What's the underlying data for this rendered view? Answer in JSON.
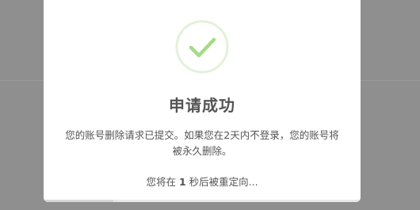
{
  "dialog": {
    "title": "申请成功",
    "message": "您的账号删除请求已提交。如果您在2天内不登录，您的账号将被永久删除。",
    "redirect_prefix": "您将在",
    "redirect_seconds": "1",
    "redirect_suffix": "秒后被重定向...",
    "icon": "checkmark-circle-icon",
    "accent_color": "#a5dc86",
    "timer_progress": 0.22
  }
}
